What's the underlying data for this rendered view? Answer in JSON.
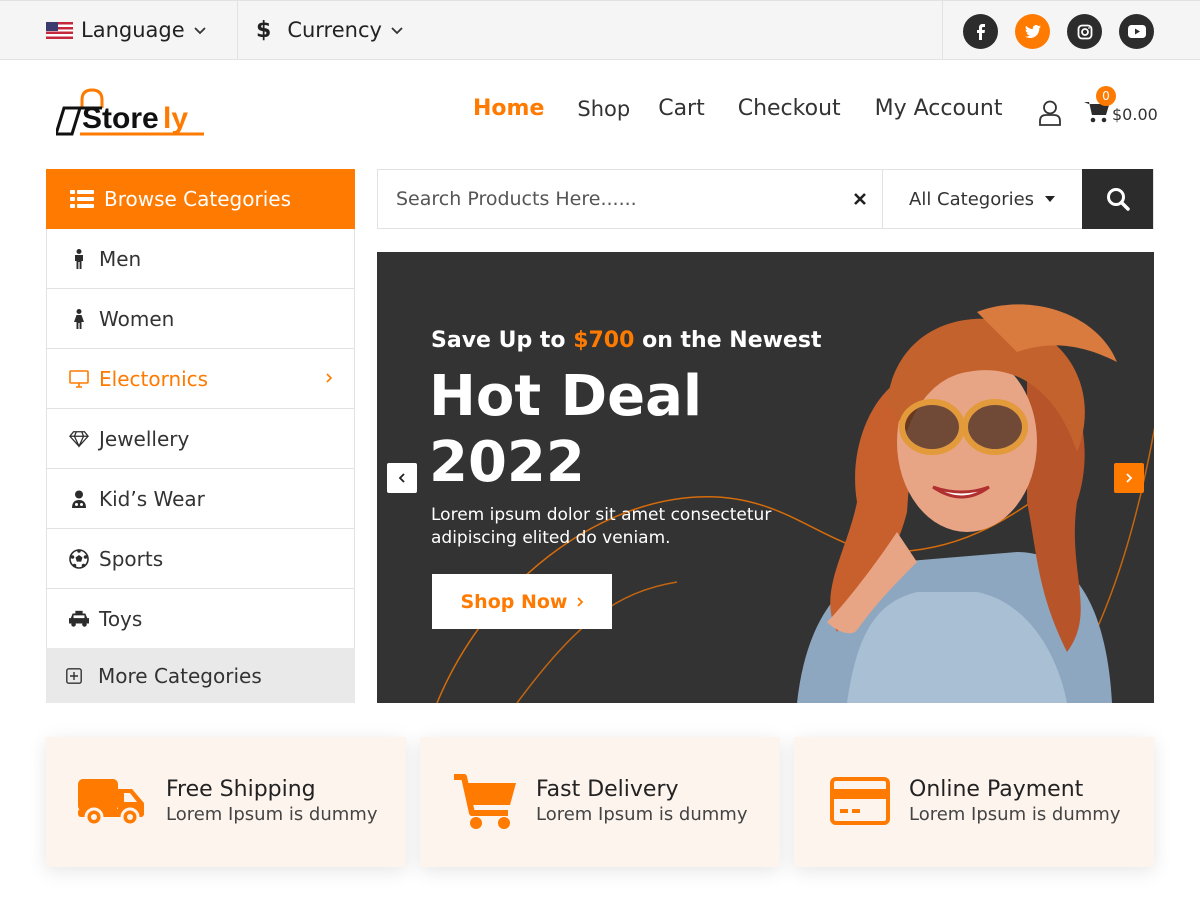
{
  "topbar": {
    "language_label": "Language",
    "currency_label": "Currency",
    "currency_symbol": "$",
    "socials": [
      "facebook-icon",
      "twitter-icon",
      "instagram-icon",
      "youtube-icon"
    ]
  },
  "brand": {
    "logo_text": "Storely",
    "accent_color": "#ff7a00",
    "dark_color": "#2c2c2c"
  },
  "nav": {
    "items": [
      {
        "label": "Home",
        "active": true
      },
      {
        "label": "Shop"
      },
      {
        "label": "Cart"
      },
      {
        "label": "Checkout"
      },
      {
        "label": "My Account"
      }
    ],
    "cart_count": "0",
    "cart_total": "$0.00"
  },
  "sidebar": {
    "header": "Browse Categories",
    "items": [
      {
        "label": "Men",
        "icon": "male-icon"
      },
      {
        "label": "Women",
        "icon": "female-icon"
      },
      {
        "label": "Electornics",
        "icon": "monitor-icon",
        "active": true
      },
      {
        "label": "Jewellery",
        "icon": "diamond-icon"
      },
      {
        "label": "Kid’s Wear",
        "icon": "child-icon"
      },
      {
        "label": "Sports",
        "icon": "soccer-ball-icon"
      },
      {
        "label": "Toys",
        "icon": "toy-car-icon"
      }
    ],
    "more_label": "More Categories"
  },
  "search": {
    "placeholder": "Search Products Here......",
    "category_label": "All Categories"
  },
  "hero": {
    "subtitle_pre": "Save Up to ",
    "subtitle_highlight": "$700",
    "subtitle_post": " on the Newest",
    "title_line1": "Hot Deal",
    "title_line2": "2022",
    "description": "Lorem ipsum dolor sit amet consectetur adipiscing elited do veniam.",
    "button_label": "Shop Now"
  },
  "features": [
    {
      "title": "Free Shipping",
      "desc": "Lorem Ipsum is dummy",
      "icon": "truck-icon"
    },
    {
      "title": "Fast Delivery",
      "desc": "Lorem Ipsum is dummy",
      "icon": "cart-icon"
    },
    {
      "title": "Online Payment",
      "desc": "Lorem Ipsum is dummy",
      "icon": "credit-card-icon"
    }
  ]
}
